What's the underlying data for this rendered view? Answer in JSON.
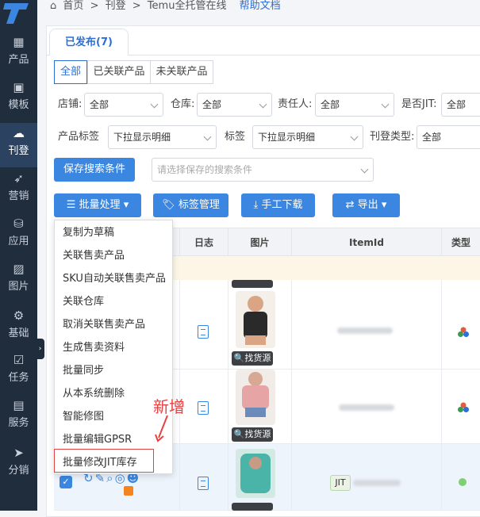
{
  "breadcrumb": {
    "home": "首页",
    "sep": ">",
    "section": "刊登",
    "page": "Temu全托管在线",
    "help": "帮助文档"
  },
  "sidebar": {
    "items": [
      {
        "label": "产品",
        "icon": "grid-icon"
      },
      {
        "label": "模板",
        "icon": "template-icon"
      },
      {
        "label": "刊登",
        "icon": "cloud-upload-icon",
        "active": true
      },
      {
        "label": "营销",
        "icon": "rocket-icon"
      },
      {
        "label": "应用",
        "icon": "bag-icon"
      },
      {
        "label": "图片",
        "icon": "image-icon"
      },
      {
        "label": "基础",
        "icon": "gear-icon"
      },
      {
        "label": "任务",
        "icon": "checklist-icon"
      },
      {
        "label": "服务",
        "icon": "briefcase-icon"
      },
      {
        "label": "分销",
        "icon": "send-icon"
      }
    ]
  },
  "tabs": {
    "published": "已发布(7)"
  },
  "filters": {
    "segments": [
      "全部",
      "已关联产品",
      "未关联产品"
    ],
    "shop_label": "店铺:",
    "shop_value": "全部",
    "warehouse_label": "仓库:",
    "warehouse_value": "全部",
    "owner_label": "责任人:",
    "owner_value": "全部",
    "jit_label": "是否JIT:",
    "jit_value": "全部",
    "product_tag_label": "产品标签",
    "product_tag_value": "下拉显示明细",
    "tag_label": "标签",
    "tag_value": "下拉显示明细",
    "listing_type_label": "刊登类型:",
    "listing_type_value": "全部",
    "save_search_button": "保存搜索条件",
    "saved_search_placeholder": "请选择保存的搜索条件"
  },
  "toolbar": {
    "batch": "批量处理",
    "tags": "标签管理",
    "download": "手工下载",
    "export": "导出"
  },
  "table": {
    "headers": [
      "日志",
      "图片",
      "ItemId",
      "类型"
    ],
    "source_label": "找货源",
    "jit_badge": "JIT"
  },
  "batch_menu": [
    "复制为草稿",
    "关联售卖产品",
    "SKU自动关联售卖产品",
    "关联仓库",
    "取消关联售卖产品",
    "生成售卖资料",
    "批量同步",
    "从本系统删除",
    "智能修图",
    "批量编辑GPSR",
    "批量修改JIT库存"
  ],
  "annotation": "新增",
  "colors": {
    "accent": "#3a86e0",
    "sidebar": "#1f2d3d",
    "highlight": "#e34343"
  }
}
